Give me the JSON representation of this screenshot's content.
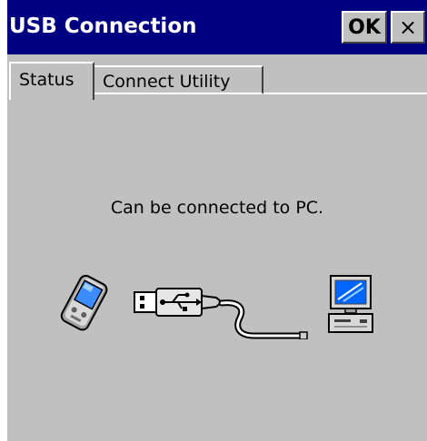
{
  "window": {
    "title": "USB Connection",
    "ok_label": "OK",
    "close_label": "×"
  },
  "tabs": [
    {
      "label": "Status",
      "selected": true
    },
    {
      "label": "Connect Utility",
      "selected": false
    }
  ],
  "status": {
    "message": "Can be connected to PC."
  },
  "illustration": {
    "icons": [
      "pda-icon",
      "usb-plug-icon",
      "usb-cable-icon",
      "pc-icon"
    ]
  },
  "colors": {
    "titlebar": "#000080",
    "face": "#c0c0c0",
    "screen": "#0066ff"
  }
}
